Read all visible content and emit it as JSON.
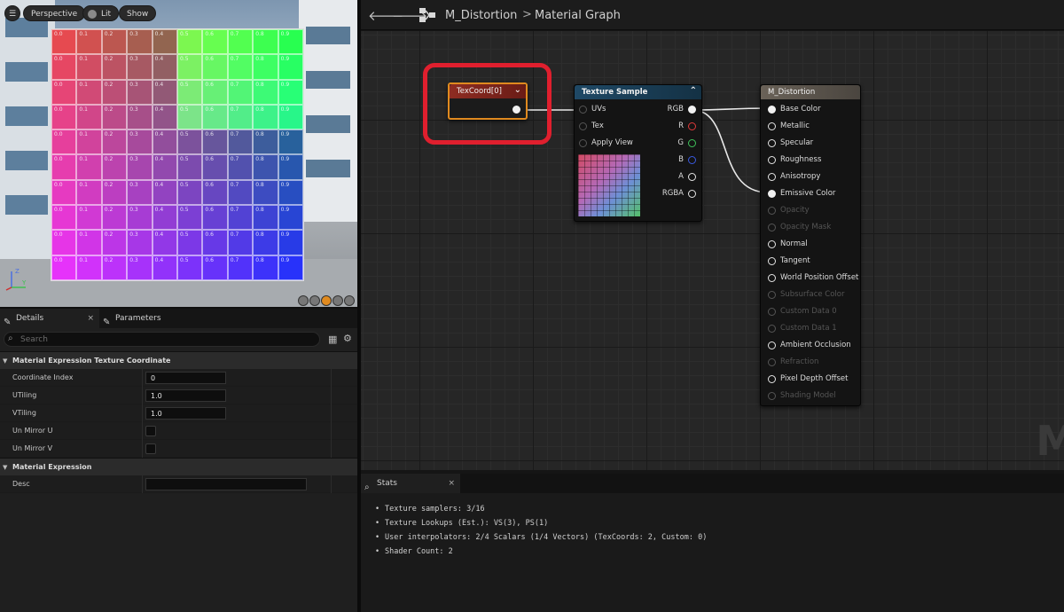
{
  "viewport": {
    "buttons": {
      "perspective": "Perspective",
      "lit": "Lit",
      "show": "Show"
    },
    "axes": {
      "z": "Z",
      "y": "Y"
    },
    "uv_grid": {
      "rows": 10,
      "cols": 10,
      "col_labels": [
        "0.0",
        "0.1",
        "0.2",
        "0.3",
        "0.4",
        "0.5",
        "0.6",
        "0.7",
        "0.8",
        "0.9"
      ]
    }
  },
  "details": {
    "tabs": [
      {
        "label": "Details"
      },
      {
        "label": "Parameters"
      }
    ],
    "search_placeholder": "Search",
    "sections": [
      {
        "title": "Material Expression Texture Coordinate",
        "props": [
          {
            "name": "Coordinate Index",
            "value": "0",
            "type": "text"
          },
          {
            "name": "UTiling",
            "value": "1.0",
            "type": "text"
          },
          {
            "name": "VTiling",
            "value": "1.0",
            "type": "text"
          },
          {
            "name": "Un Mirror U",
            "type": "checkbox"
          },
          {
            "name": "Un Mirror V",
            "type": "checkbox"
          }
        ]
      },
      {
        "title": "Material Expression",
        "props": [
          {
            "name": "Desc",
            "value": "",
            "type": "text-wide"
          }
        ]
      }
    ]
  },
  "graph": {
    "breadcrumb": {
      "asset": "M_Distortion",
      "sep": ">",
      "graph": "Material Graph"
    },
    "texcoord_node": {
      "title": "TexCoord[0]"
    },
    "texsample_node": {
      "title": "Texture Sample",
      "inputs": [
        "UVs",
        "Tex",
        "Apply View MipBias"
      ],
      "outputs": [
        "RGB",
        "R",
        "G",
        "B",
        "A",
        "RGBA"
      ]
    },
    "result_node": {
      "title": "M_Distortion",
      "pins": [
        {
          "label": "Base Color",
          "state": "connected"
        },
        {
          "label": "Metallic",
          "state": "active"
        },
        {
          "label": "Specular",
          "state": "active"
        },
        {
          "label": "Roughness",
          "state": "active"
        },
        {
          "label": "Anisotropy",
          "state": "active"
        },
        {
          "label": "Emissive Color",
          "state": "connected"
        },
        {
          "label": "Opacity",
          "state": "disabled"
        },
        {
          "label": "Opacity Mask",
          "state": "disabled"
        },
        {
          "label": "Normal",
          "state": "active"
        },
        {
          "label": "Tangent",
          "state": "active"
        },
        {
          "label": "World Position Offset",
          "state": "active"
        },
        {
          "label": "Subsurface Color",
          "state": "disabled"
        },
        {
          "label": "Custom Data 0",
          "state": "disabled"
        },
        {
          "label": "Custom Data 1",
          "state": "disabled"
        },
        {
          "label": "Ambient Occlusion",
          "state": "active"
        },
        {
          "label": "Refraction",
          "state": "disabled"
        },
        {
          "label": "Pixel Depth Offset",
          "state": "active"
        },
        {
          "label": "Shading Model",
          "state": "disabled"
        }
      ]
    },
    "watermark": "M"
  },
  "stats": {
    "tab_label": "Stats",
    "lines": [
      "Texture samplers: 3/16",
      "Texture Lookups (Est.): VS(3), PS(1)",
      "User interpolators: 2/4 Scalars (1/4 Vectors) (TexCoords: 2, Custom: 0)",
      "Shader Count: 2"
    ]
  },
  "colors": {
    "highlight": "#e01f2e",
    "selection": "#e08a1f",
    "pin_r": "#e03a3a",
    "pin_g": "#3ec25a",
    "pin_b": "#3a5ae0"
  }
}
